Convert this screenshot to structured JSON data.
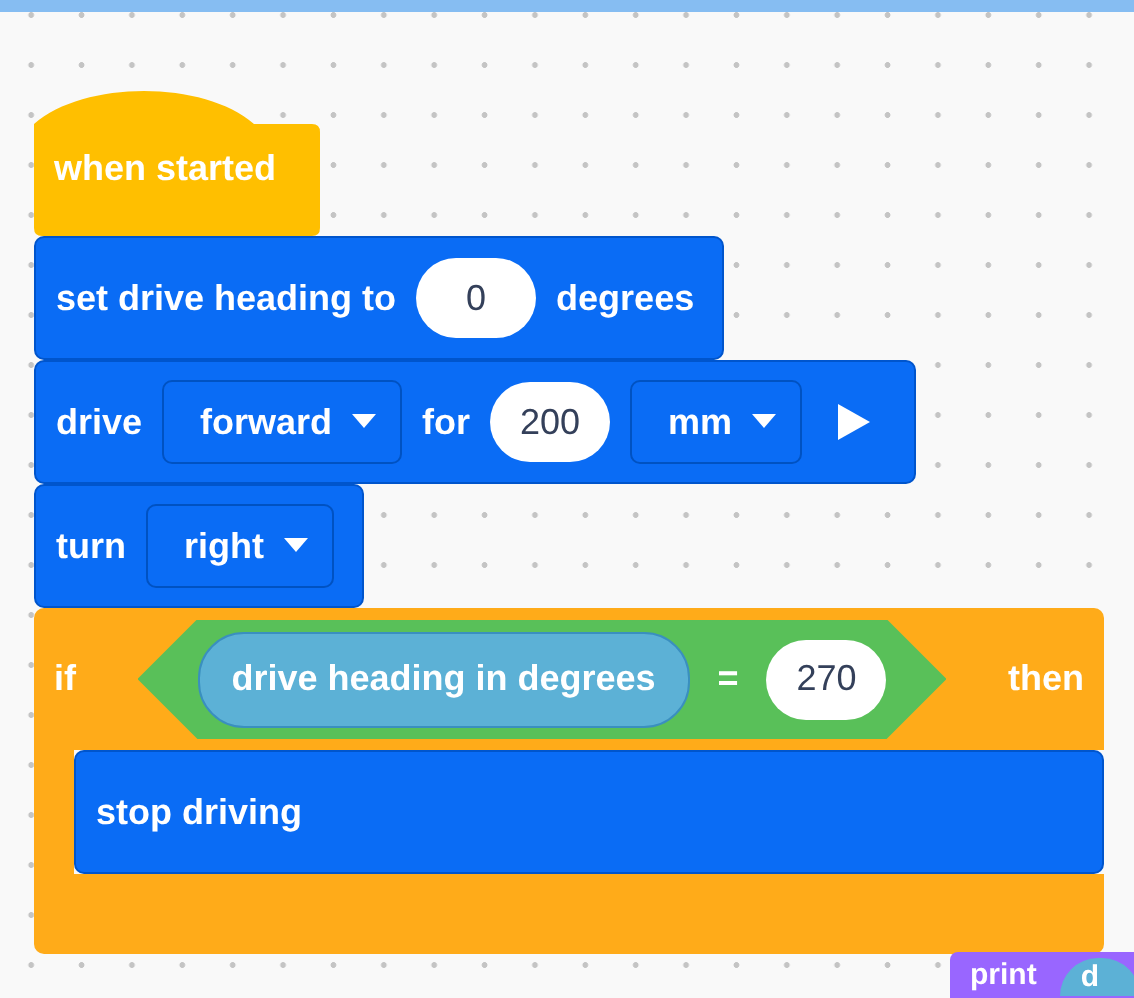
{
  "hat": {
    "label": "when started"
  },
  "blocks": [
    {
      "kind": "command",
      "parts": [
        {
          "kind": "text",
          "text": "set drive heading to"
        },
        {
          "kind": "number",
          "value": "0"
        },
        {
          "kind": "text",
          "text": "degrees"
        }
      ]
    },
    {
      "kind": "command",
      "parts": [
        {
          "kind": "text",
          "text": "drive"
        },
        {
          "kind": "dropdown",
          "value": "forward"
        },
        {
          "kind": "text",
          "text": "for"
        },
        {
          "kind": "number",
          "value": "200"
        },
        {
          "kind": "dropdown",
          "value": "mm"
        },
        {
          "kind": "run"
        }
      ]
    },
    {
      "kind": "command",
      "parts": [
        {
          "kind": "text",
          "text": "turn"
        },
        {
          "kind": "dropdown",
          "value": "right"
        }
      ]
    },
    {
      "kind": "if",
      "label": "if",
      "then": "then",
      "condition": {
        "reporter": "drive heading in degrees",
        "operator": "=",
        "value": "270"
      },
      "children": [
        {
          "kind": "command",
          "parts": [
            {
              "kind": "text",
              "text": "stop driving"
            }
          ]
        }
      ]
    }
  ],
  "floating": [
    {
      "label": "print",
      "argument": "d"
    }
  ]
}
